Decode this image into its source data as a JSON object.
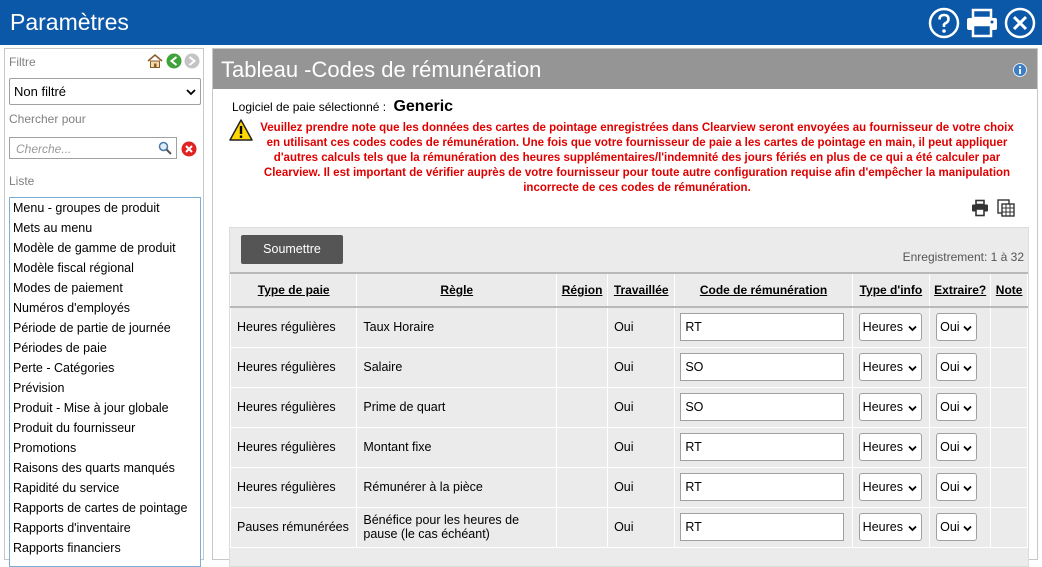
{
  "app": {
    "title": "Paramètres",
    "help_icon": "help-icon",
    "print_icon": "print-icon",
    "close_icon": "close-icon",
    "brand_color": "#0b57a8"
  },
  "sidebar": {
    "filter_label": "Filtre",
    "filter_value": "Non filtré",
    "search_label": "Chercher pour",
    "search_placeholder": "Cherche...",
    "list_label": "Liste",
    "items": [
      "Menu - groupes de produit",
      "Mets au menu",
      "Modèle de gamme de produit",
      "Modèle fiscal régional",
      "Modes de paiement",
      "Numéros d'employés",
      "Période de partie de journée",
      "Périodes de paie",
      "Perte - Catégories",
      "Prévision",
      "Produit - Mise à jour globale",
      "Produit du fournisseur",
      "Promotions",
      "Raisons des quarts manqués",
      "Rapidité du service",
      "Rapports de cartes de pointage",
      "Rapports d'inventaire",
      "Rapports financiers"
    ]
  },
  "main": {
    "title": "Tableau -Codes de rémunération",
    "software_label": "Logiciel de paie sélectionné :",
    "software_name": "Generic",
    "warning": "Veuillez prendre note que les données des cartes de pointage enregistrées dans Clearview seront envoyées au fournisseur de votre choix en utilisant ces codes codes de rémunération.  Une fois que votre fournisseur de paie a les cartes de pointage en main, il peut appliquer d'autres calculs tels que la rémunération des heures supplémentaires/l'indemnité des jours fériés en plus de ce qui a été calculer par Clearview. Il est important de vérifier auprès de votre fournisseur pour toute autre configuration requise afin d'empêcher la manipulation incorrecte de ces codes de rémunération.",
    "warning_color": "#e00000",
    "submit_label": "Soumettre",
    "record_count": "Enregistrement: 1  à 32",
    "columns": {
      "type_paie": "Type de paie",
      "regle": "Règle",
      "region": "Région",
      "travaillee": "Travaillée",
      "code": "Code de rémunération",
      "type_info": "Type d'info",
      "extraire": "Extraire?",
      "note": "Note"
    },
    "rows": [
      {
        "type": "Heures régulières",
        "rule": "Taux Horaire",
        "region": "",
        "worked": "Oui",
        "code": "RT",
        "info": "Heures",
        "extract": "Oui"
      },
      {
        "type": "Heures régulières",
        "rule": "Salaire",
        "region": "",
        "worked": "Oui",
        "code": "SO",
        "info": "Heures",
        "extract": "Oui"
      },
      {
        "type": "Heures régulières",
        "rule": "Prime de quart",
        "region": "",
        "worked": "Oui",
        "code": "SO",
        "info": "Heures",
        "extract": "Oui"
      },
      {
        "type": "Heures régulières",
        "rule": "Montant fixe",
        "region": "",
        "worked": "Oui",
        "code": "RT",
        "info": "Heures",
        "extract": "Oui"
      },
      {
        "type": "Heures régulières",
        "rule": "Rémunérer à la pièce",
        "region": "",
        "worked": "Oui",
        "code": "RT",
        "info": "Heures",
        "extract": "Oui"
      },
      {
        "type": "Pauses rémunérées",
        "rule": "Bénéfice pour les heures de pause (le cas échéant)",
        "region": "",
        "worked": "Oui",
        "code": "RT",
        "info": "Heures",
        "extract": "Oui"
      }
    ]
  }
}
